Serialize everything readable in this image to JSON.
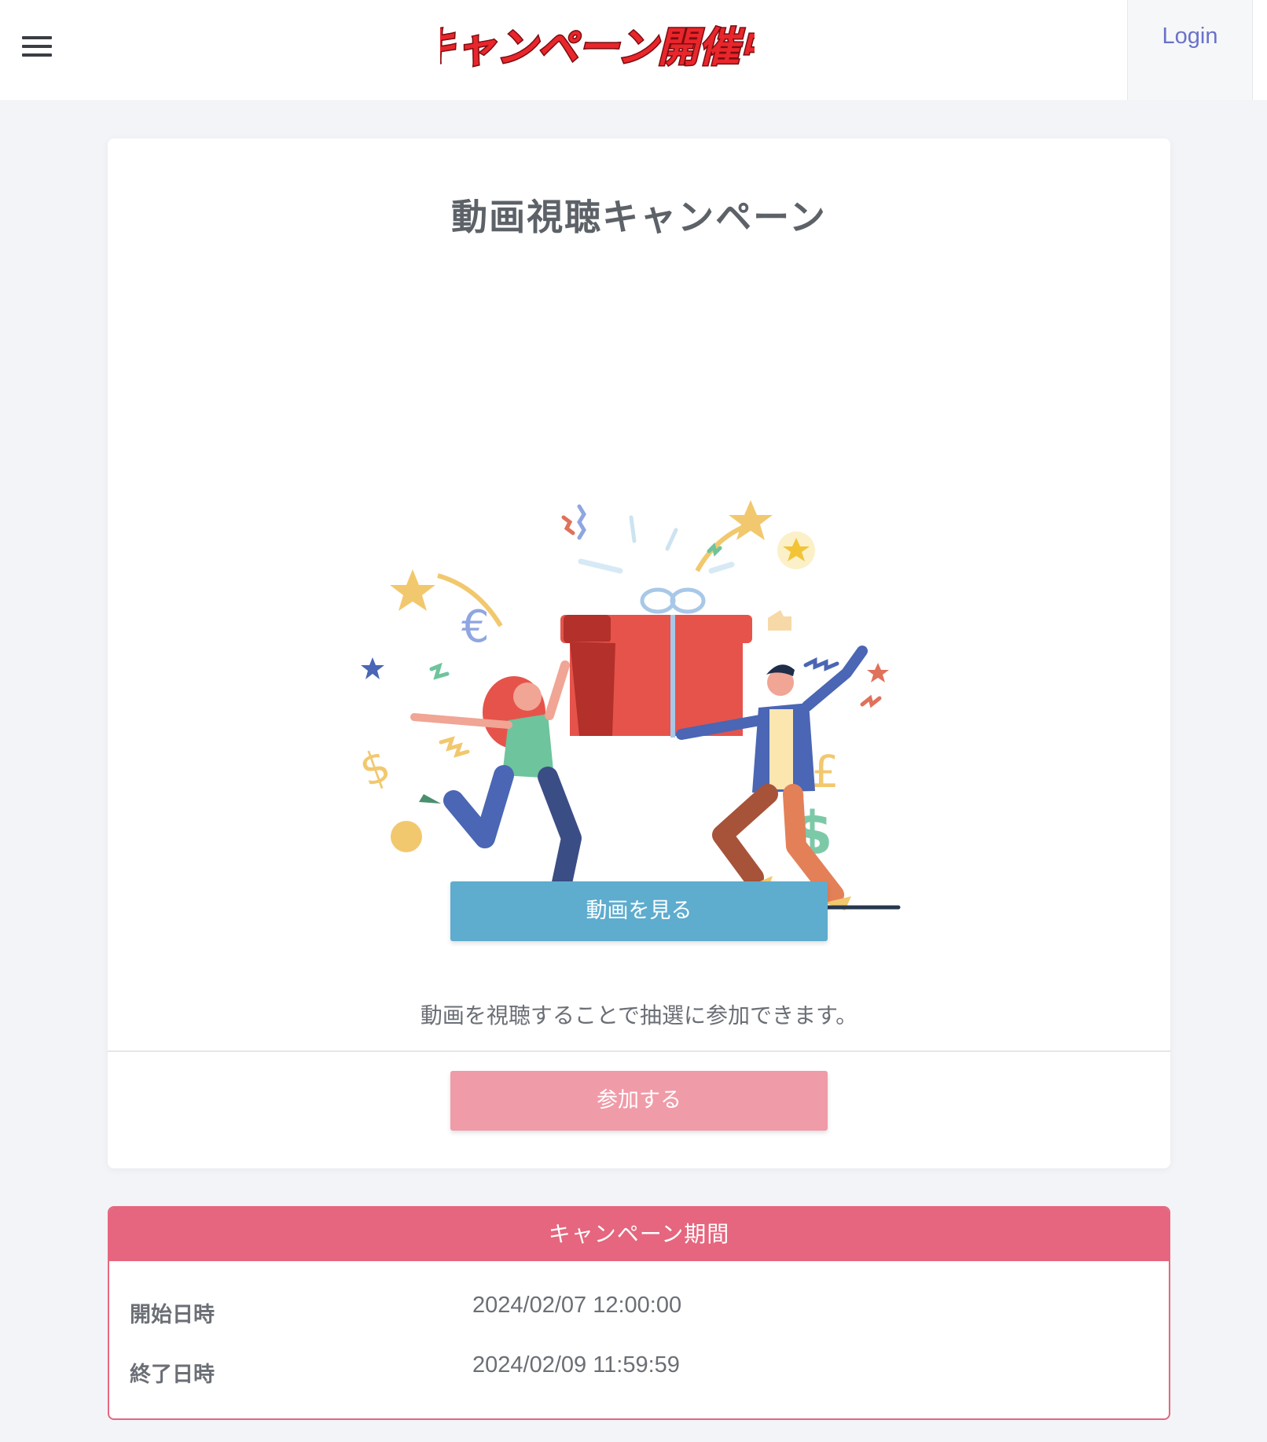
{
  "header": {
    "logo_text": "キャンペーン開催中",
    "login_label": "Login"
  },
  "card": {
    "title": "動画視聴キャンペーン",
    "watch_button": "動画を見る",
    "description": "動画を視聴することで抽選に参加できます。",
    "join_button": "参加する"
  },
  "period": {
    "heading": "キャンペーン期間",
    "rows": [
      {
        "label": "開始日時",
        "value": "2024/02/07 12:00:00"
      },
      {
        "label": "終了日時",
        "value": "2024/02/09 11:59:59"
      }
    ]
  },
  "colors": {
    "accent_pink": "#e5667e",
    "watch_button": "#5eacce",
    "join_button": "#f09ba8",
    "login_link": "#6a72c9"
  }
}
